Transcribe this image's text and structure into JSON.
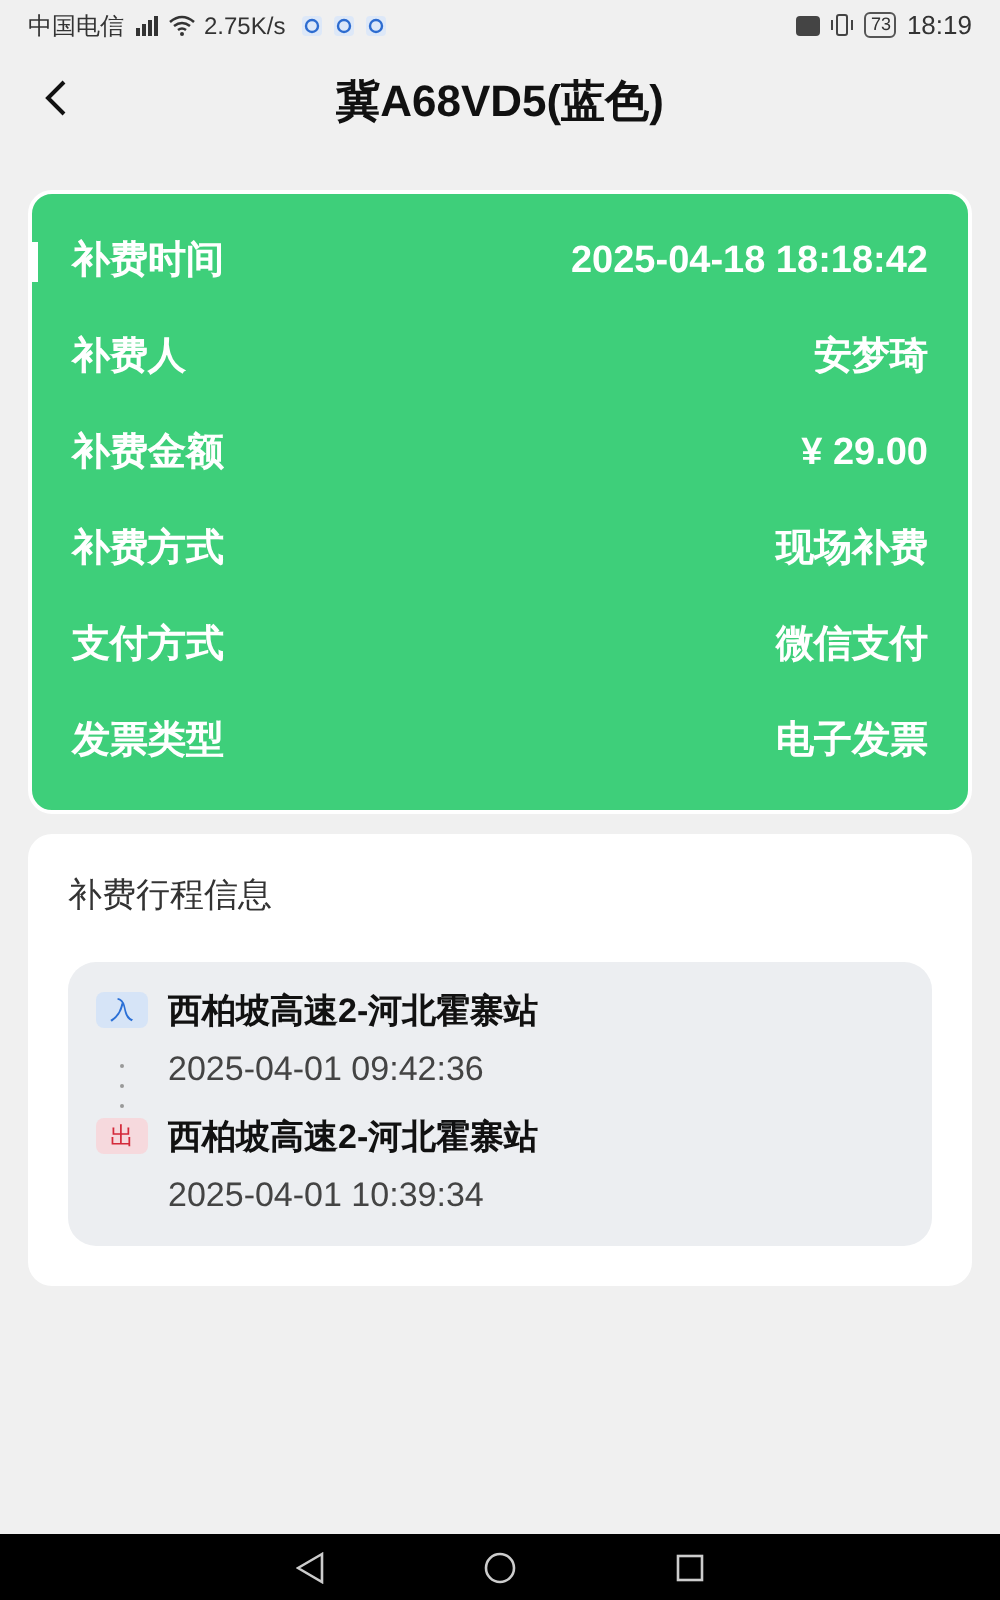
{
  "status_bar": {
    "carrier": "中国电信",
    "speed": "2.75K/s",
    "battery": "73",
    "time": "18:19"
  },
  "header": {
    "title": "冀A68VD5(蓝色)"
  },
  "payment": {
    "rows": [
      {
        "label": "补费时间",
        "value": "2025-04-18 18:18:42",
        "selected": true
      },
      {
        "label": "补费人",
        "value": "安梦琦",
        "selected": false
      },
      {
        "label": "补费金额",
        "value": "¥ 29.00",
        "selected": false
      },
      {
        "label": "补费方式",
        "value": "现场补费",
        "selected": false
      },
      {
        "label": "支付方式",
        "value": "微信支付",
        "selected": false
      },
      {
        "label": "发票类型",
        "value": "电子发票",
        "selected": false
      }
    ]
  },
  "trip": {
    "title": "补费行程信息",
    "stops": [
      {
        "kind": "entry",
        "badge": "入",
        "station": "西柏坡高速2-河北霍寨站",
        "time": "2025-04-01 09:42:36"
      },
      {
        "kind": "exit",
        "badge": "出",
        "station": "西柏坡高速2-河北霍寨站",
        "time": "2025-04-01 10:39:34"
      }
    ]
  }
}
